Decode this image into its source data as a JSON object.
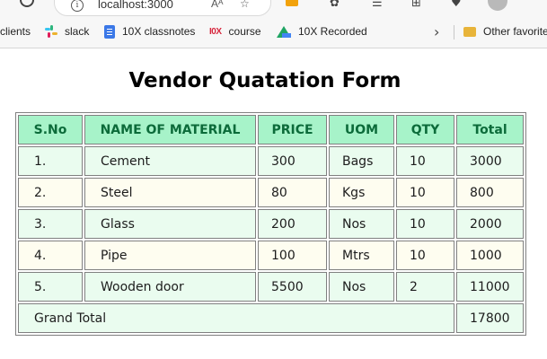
{
  "browser": {
    "url": "localhost:3000",
    "read_aloud_label": "Aᴬ",
    "bookmarks": [
      {
        "label": "clients"
      },
      {
        "label": "slack"
      },
      {
        "label": "10X classnotes"
      },
      {
        "label": "course"
      },
      {
        "label": "10X Recorded"
      }
    ],
    "other_favorites": "Other favorites",
    "chevron": "›"
  },
  "page": {
    "title": "Vendor Quatation Form"
  },
  "table": {
    "headers": [
      "S.No",
      "NAME OF MATERIAL",
      "PRICE",
      "UOM",
      "QTY",
      "Total"
    ],
    "rows": [
      [
        "1.",
        "Cement",
        "300",
        "Bags",
        "10",
        "3000"
      ],
      [
        "2.",
        "Steel",
        "80",
        "Kgs",
        "10",
        "800"
      ],
      [
        "3.",
        "Glass",
        "200",
        "Nos",
        "10",
        "2000"
      ],
      [
        "4.",
        "Pipe",
        "100",
        "Mtrs",
        "10",
        "1000"
      ],
      [
        "5.",
        "Wooden door",
        "5500",
        "Nos",
        "2",
        "11000"
      ]
    ],
    "grand_total_label": "Grand Total",
    "grand_total_value": "17800"
  },
  "colors": {
    "header_bg": "#a7f3c9",
    "header_text": "#0c6b3a",
    "row_green": "#eafcef",
    "row_cream": "#fefdf0"
  }
}
